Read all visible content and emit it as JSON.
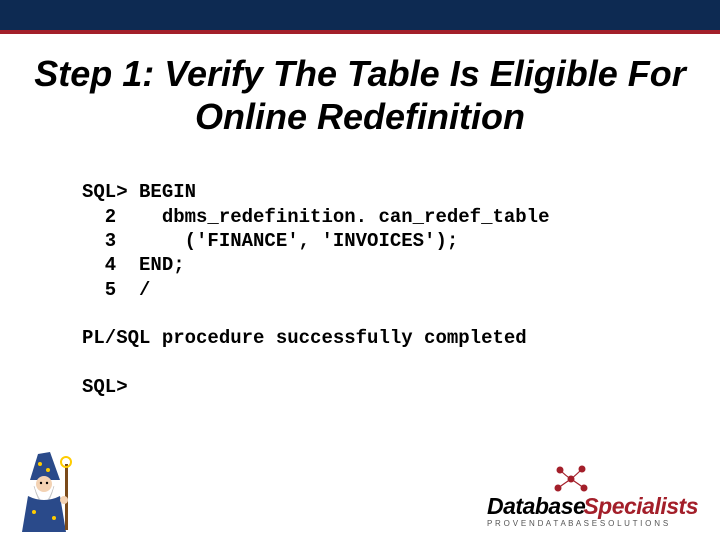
{
  "slide": {
    "title": "Step 1: Verify The Table Is Eligible For Online Redefinition"
  },
  "code": {
    "line1": "SQL> BEGIN",
    "line2": "  2    dbms_redefinition. can_redef_table",
    "line3": "  3      ('FINANCE', 'INVOICES');",
    "line4": "  4  END;",
    "line5": "  5  /",
    "blank1": "",
    "result": "PL/SQL procedure successfully completed",
    "blank2": "",
    "prompt": "SQL>"
  },
  "branding": {
    "word1": "Database",
    "word2": "Specialists",
    "tagline": "P R O V E N  D A T A B A S E  S O L U T I O N S"
  }
}
